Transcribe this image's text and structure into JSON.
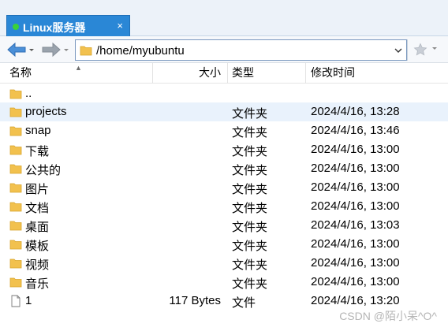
{
  "tab": {
    "title": "Linux服务器",
    "close": "×"
  },
  "address": {
    "path": "/home/myubuntu"
  },
  "columns": {
    "name": "名称",
    "size": "大小",
    "type": "类型",
    "modified": "修改时间"
  },
  "rows": [
    {
      "name": "..",
      "size": "",
      "type": "",
      "modified": "",
      "icon": "folder-up-icon"
    },
    {
      "name": "projects",
      "size": "",
      "type": "文件夹",
      "modified": "2024/4/16, 13:28",
      "icon": "folder-icon"
    },
    {
      "name": "snap",
      "size": "",
      "type": "文件夹",
      "modified": "2024/4/16, 13:46",
      "icon": "folder-icon"
    },
    {
      "name": "下载",
      "size": "",
      "type": "文件夹",
      "modified": "2024/4/16, 13:00",
      "icon": "folder-icon"
    },
    {
      "name": "公共的",
      "size": "",
      "type": "文件夹",
      "modified": "2024/4/16, 13:00",
      "icon": "folder-icon"
    },
    {
      "name": "图片",
      "size": "",
      "type": "文件夹",
      "modified": "2024/4/16, 13:00",
      "icon": "folder-icon"
    },
    {
      "name": "文档",
      "size": "",
      "type": "文件夹",
      "modified": "2024/4/16, 13:00",
      "icon": "folder-icon"
    },
    {
      "name": "桌面",
      "size": "",
      "type": "文件夹",
      "modified": "2024/4/16, 13:03",
      "icon": "folder-icon"
    },
    {
      "name": "模板",
      "size": "",
      "type": "文件夹",
      "modified": "2024/4/16, 13:00",
      "icon": "folder-icon"
    },
    {
      "name": "视频",
      "size": "",
      "type": "文件夹",
      "modified": "2024/4/16, 13:00",
      "icon": "folder-icon"
    },
    {
      "name": "音乐",
      "size": "",
      "type": "文件夹",
      "modified": "2024/4/16, 13:00",
      "icon": "folder-icon"
    },
    {
      "name": "1",
      "size": "117 Bytes",
      "type": "文件",
      "modified": "2024/4/16, 13:20",
      "icon": "file-icon"
    }
  ],
  "watermark": "CSDN @陌小呆^O^",
  "colors": {
    "tab": "#2a87d6",
    "folder": "#f2c14e",
    "nav_arrow": "#4a8fd8",
    "row_hover": "#e9f2fc"
  }
}
